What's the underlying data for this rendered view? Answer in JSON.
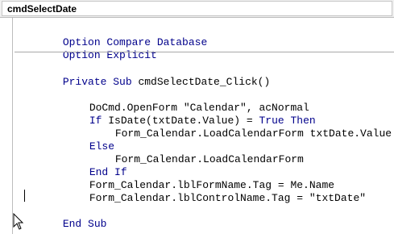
{
  "procedure_dropdown": {
    "selected": "cmdSelectDate"
  },
  "code": {
    "declarations": [
      {
        "keyword": "Option Compare Database",
        "rest": ""
      },
      {
        "keyword": "Option Explicit",
        "rest": ""
      }
    ],
    "sub_header": {
      "kw1": "Private Sub",
      "rest": " cmdSelectDate_Click()"
    },
    "open_form": "DoCmd.OpenForm \"Calendar\", acNormal",
    "if_line": {
      "kw_if": "If",
      "mid": " IsDate(txtDate.Value) = ",
      "kw_true": "True",
      "sp": " ",
      "kw_then": "Then"
    },
    "load_with_value": "Form_Calendar.LoadCalendarForm txtDate.Value",
    "else_kw": "Else",
    "load_plain": "Form_Calendar.LoadCalendarForm",
    "end_if_kw": "End If",
    "tag_form": "Form_Calendar.lblFormName.Tag = Me.Name",
    "tag_control": "Form_Calendar.lblControlName.Tag = \"txtDate\"",
    "end_sub_kw": "End Sub"
  },
  "colors": {
    "keyword": "#00008b",
    "text": "#000000"
  },
  "icons": {
    "mouse": "mouse-pointer-icon"
  }
}
